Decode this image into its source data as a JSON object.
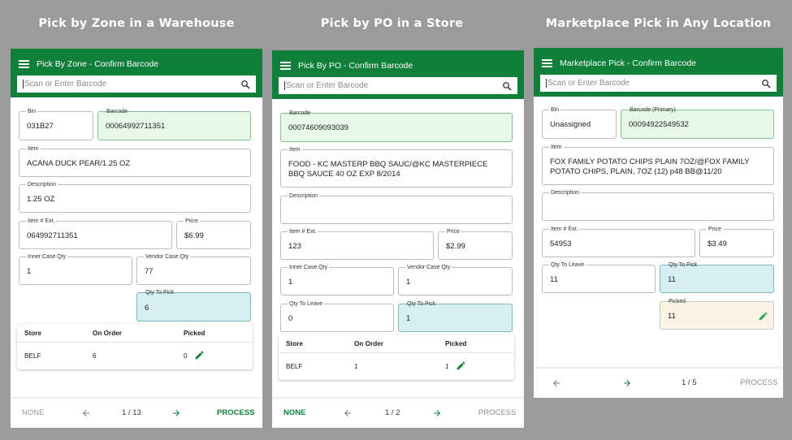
{
  "headings": [
    "Pick by Zone in a Warehouse",
    "Pick by PO in a Store",
    "Marketplace Pick in Any Location"
  ],
  "colors": {
    "brand_green": "#0f7f3a",
    "barcode_field_bg": "#e7f8e9",
    "qty_to_pick_bg": "#d6eff3",
    "picked_bg": "#fbf3e4"
  },
  "icons": [
    "menu-icon",
    "search-icon",
    "pencil-icon",
    "arrow-left-icon",
    "arrow-right-icon"
  ],
  "panel1": {
    "title": "Pick By Zone - Confirm Barcode",
    "search_placeholder": "Scan or Enter Barcode",
    "bin_label": "Bin",
    "bin_value": "031B27",
    "barcode_label": "Barcode",
    "barcode_value": "00064992711351",
    "item_label": "Item",
    "item_value": "ACANA DUCK PEAR/1.25 OZ",
    "description_label": "Description",
    "description_value": "1.25 OZ",
    "item_ext_label": "Item # Ext.",
    "item_ext_value": "064992711351",
    "price_label": "Price",
    "price_value": "$6.99",
    "inner_case_label": "Inner Case Qty",
    "inner_case_value": "1",
    "vendor_case_label": "Vendor Case Qty",
    "vendor_case_value": "77",
    "qty_to_pick_label": "Qty To Pick",
    "qty_to_pick_value": "6",
    "table": {
      "headers": [
        "Store",
        "On Order",
        "Picked"
      ],
      "row": [
        "BELF",
        "6",
        "0"
      ]
    },
    "footer": {
      "none": "NONE",
      "page": "1 / 13",
      "process": "PROCESS"
    }
  },
  "panel2": {
    "title": "Pick By PO - Confirm Barcode",
    "search_placeholder": "Scan or Enter Barcode",
    "barcode_label": "Barcode",
    "barcode_value": "00074609093039",
    "item_label": "Item",
    "item_line1": "FOOD - KC MASTERP BBQ SAUC/@KC MASTERPIECE",
    "item_line2": "BBQ SAUCE 40 OZ EXP 8/2014",
    "description_label": "Description",
    "description_value": "",
    "item_ext_label": "Item # Ext.",
    "item_ext_value": "123",
    "price_label": "Price",
    "price_value": "$2.99",
    "inner_case_label": "Inner Case Qty",
    "inner_case_value": "1",
    "vendor_case_label": "Vendor Case Qty",
    "vendor_case_value": "1",
    "qty_to_leave_label": "Qty To Leave",
    "qty_to_leave_value": "0",
    "qty_to_pick_label": "Qty To Pick",
    "qty_to_pick_value": "1",
    "table": {
      "headers": [
        "Store",
        "On Order",
        "Picked"
      ],
      "row": [
        "BELF",
        "1",
        "1"
      ]
    },
    "footer": {
      "none": "NONE",
      "page": "1 / 2",
      "process": "PROCESS"
    }
  },
  "panel3": {
    "title": "Marketplace Pick - Confirm Barcode",
    "search_placeholder": "Scan or Enter Barcode",
    "bin_label": "Bin",
    "bin_value": "Unassigned",
    "barcode_label": "Barcode (Primary)",
    "barcode_value": "00094922549532",
    "item_label": "Item",
    "item_line1": "FOX FAMILY POTATO CHIPS PLAIN 7OZ/@FOX FAMILY",
    "item_line2": "POTATO CHIPS, PLAIN, 7OZ (12) p48 BB@11/20",
    "description_label": "Description",
    "description_value": "",
    "item_ext_label": "Item # Ext.",
    "item_ext_value": "54953",
    "price_label": "Price",
    "price_value": "$3.49",
    "qty_to_leave_label": "Qty To Leave",
    "qty_to_leave_value": "11",
    "qty_to_pick_label": "Qty To Pick",
    "qty_to_pick_value": "11",
    "picked_label": "Picked",
    "picked_value": "11",
    "footer": {
      "page": "1 / 5",
      "process": "PROCESS"
    }
  }
}
